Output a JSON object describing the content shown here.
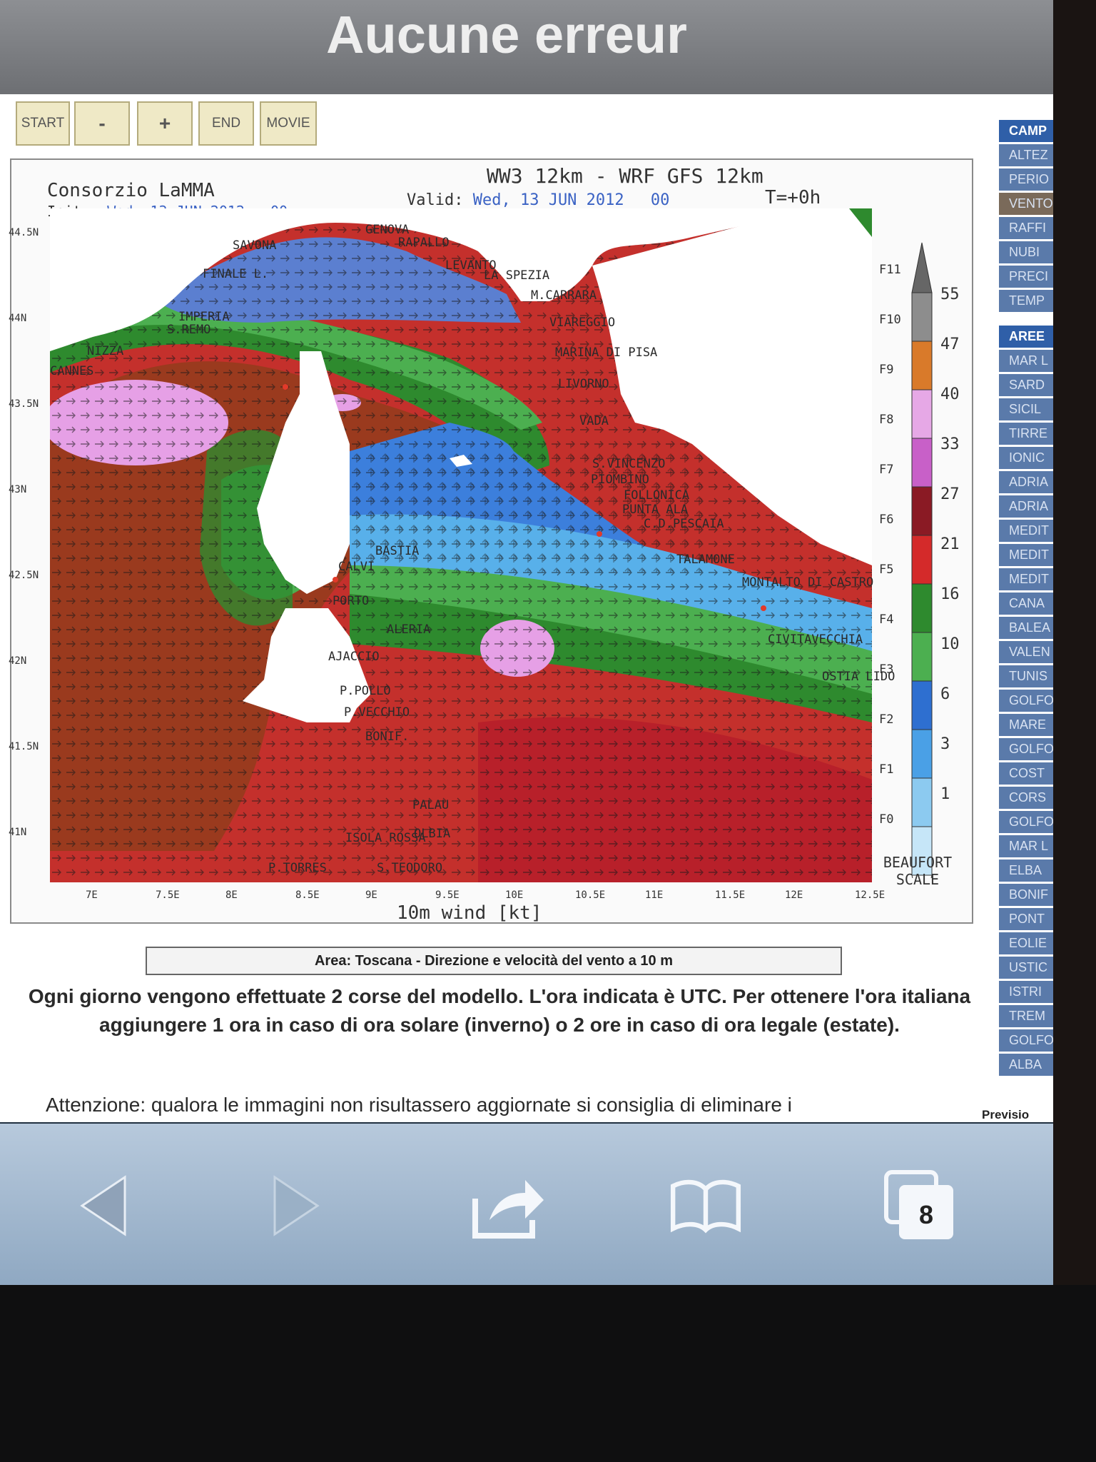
{
  "window": {
    "title": "Aucune erreur"
  },
  "controls": {
    "start": "START",
    "minus": "-",
    "plus": "+",
    "end": "END",
    "movie": "MOVIE"
  },
  "map": {
    "org": "Consorzio LaMMA",
    "init_label": "Init.:",
    "init_value": "Wed, 13 JUN 2012",
    "init_hour": "00",
    "model": "WW3 12km - WRF GFS 12km",
    "valid_label": "Valid:",
    "valid_value": "Wed, 13 JUN 2012",
    "valid_hour": "00",
    "t_offset": "T=+0h",
    "x_title": "10m wind [kt]",
    "lat_ticks": [
      "44.5N",
      "44N",
      "43.5N",
      "43N",
      "42.5N",
      "42N",
      "41.5N",
      "41N"
    ],
    "lon_ticks": [
      "7E",
      "7.5E",
      "8E",
      "8.5E",
      "9E",
      "9.5E",
      "10E",
      "10.5E",
      "11E",
      "11.5E",
      "12E",
      "12.5E"
    ],
    "places": [
      "GENOVA",
      "SAVONA",
      "RAPALLO",
      "LEVANTO",
      "LA SPEZIA",
      "FINALE L.",
      "M.CARRARA",
      "IMPERIA",
      "S.REMO",
      "VIAREGGIO",
      "NIZZA",
      "MARINA DI PISA",
      "CANNES",
      "LIVORNO",
      "VADA",
      "S.VINCENZO",
      "PIOMBINO",
      "FOLLONICA",
      "PUNTA ALA",
      "C.D.PESCAIA",
      "BASTIA",
      "TALAMONE",
      "CALVI",
      "MONTALTO DI CASTRO",
      "PORTO",
      "ALERIA",
      "CIVITAVECCHIA",
      "AJACCIO",
      "OSTIA LIDO",
      "P.POLLO",
      "P.VECCHIO",
      "BONIF.",
      "PALAU",
      "OLBIA",
      "ISOLA ROSSA",
      "P.TORRES",
      "S.TEODORO"
    ],
    "legend": {
      "beaufort": [
        "F11",
        "F10",
        "F9",
        "F8",
        "F7",
        "F6",
        "F5",
        "F4",
        "F3",
        "F2",
        "F1",
        "F0"
      ],
      "knots": [
        "55",
        "47",
        "40",
        "33",
        "27",
        "21",
        "16",
        "10",
        "6",
        "3",
        "1"
      ],
      "caption": "BEAUFORT SCALE",
      "colors": [
        "#8d8d8d",
        "#d97a2a",
        "#e6a8e6",
        "#c860c8",
        "#8a1a24",
        "#d42a2a",
        "#2e8a2e",
        "#4caf50",
        "#2e6fd0",
        "#4aa0e6",
        "#8ccaf0",
        "#c6e6f8"
      ]
    }
  },
  "caption": "Area: Toscana - Direzione e velocità del vento a 10 m",
  "paragraph": "Ogni giorno vengono effettuate 2 corse del modello. L'ora indicata è UTC. Per ottenere l'ora italiana aggiungere 1 ora in caso di ora solare (inverno) o 2 ore in caso di ora legale (estate).",
  "warning": "Attenzione: qualora le immagini non risultassero aggiornate si consiglia di eliminare i",
  "previs": "Previsio",
  "sidebar": {
    "head1": "CAMP",
    "items1": [
      "ALTEZ",
      "PERIO",
      "VENTO",
      "RAFFI",
      "NUBI",
      "PRECI",
      "TEMP"
    ],
    "head2": "AREE",
    "items2": [
      "MAR L",
      "SARD",
      "SICIL",
      "TIRRE",
      "IONIC",
      "ADRIA",
      "ADRIA",
      "MEDIT",
      "MEDIT",
      "MEDIT",
      "CANA",
      "BALEA",
      "VALEN",
      "TUNIS",
      "GOLFO",
      "MARE",
      "GOLFO",
      "COST",
      "CORS",
      "GOLFO",
      "MAR L",
      "ELBA",
      "BONIF",
      "PONT",
      "EOLIE",
      "USTIC",
      "ISTRI",
      "TREM",
      "GOLFO",
      "ALBA"
    ]
  },
  "toolbar": {
    "tabs_count": "8"
  }
}
